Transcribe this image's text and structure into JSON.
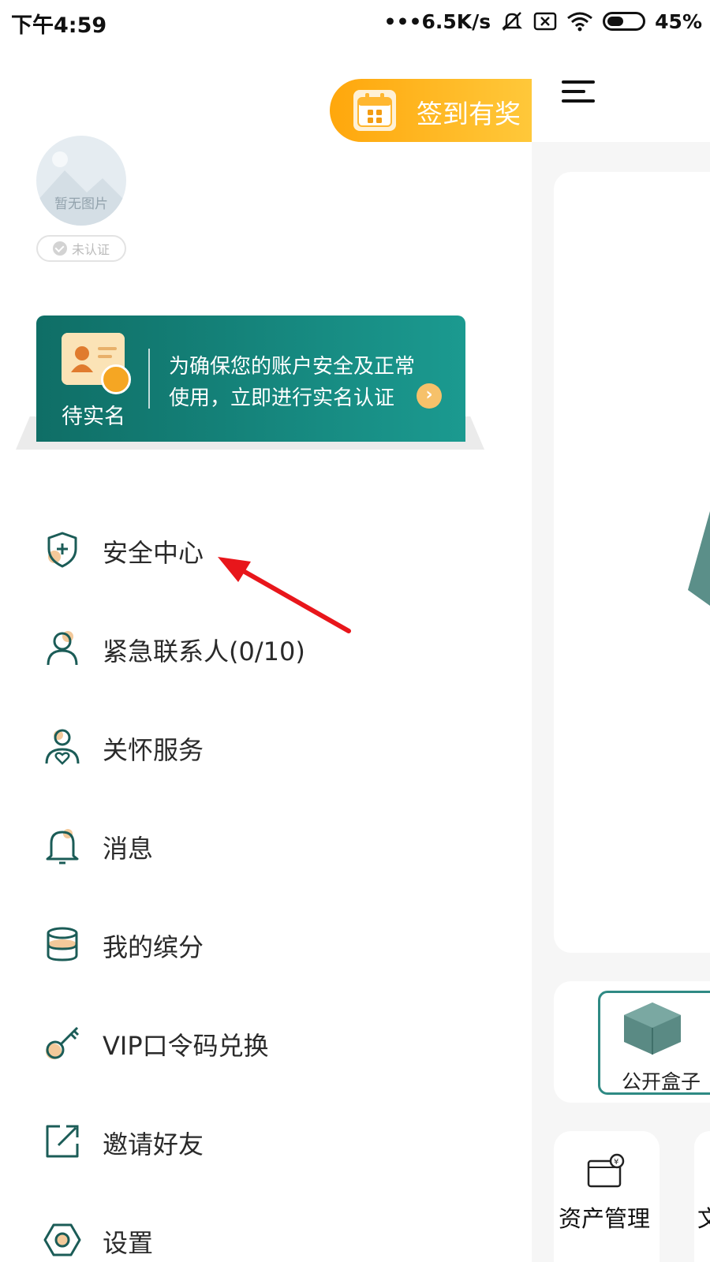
{
  "status_bar": {
    "time": "下午4:59",
    "network_speed": "6.5K/s",
    "battery": "45%"
  },
  "header": {
    "sign_in_label": "签到有奖"
  },
  "profile": {
    "avatar_placeholder": "暂无图片",
    "verify_status": "未认证"
  },
  "banner": {
    "status_label": "待实名",
    "line1": "为确保您的账户安全及正常",
    "line2": "使用，立即进行实名认证"
  },
  "menu": {
    "items": [
      {
        "label": "安全中心",
        "icon": "shield-icon"
      },
      {
        "label": "紧急联系人(0/10)",
        "icon": "contact-person-icon"
      },
      {
        "label": "关怀服务",
        "icon": "care-service-icon"
      },
      {
        "label": "消息",
        "icon": "bell-icon"
      },
      {
        "label": "我的缤分",
        "icon": "coins-icon"
      },
      {
        "label": "VIP口令码兑换",
        "icon": "key-icon"
      },
      {
        "label": "邀请好友",
        "icon": "share-icon"
      },
      {
        "label": "设置",
        "icon": "settings-icon"
      }
    ]
  },
  "background_page": {
    "public_box_label": "公开盒子",
    "asset_label": "资产管理",
    "cut_label": "文"
  },
  "colors": {
    "brand_teal": "#1b7f77",
    "accent_orange": "#ffa70c",
    "annotation_red": "#e8161b"
  }
}
